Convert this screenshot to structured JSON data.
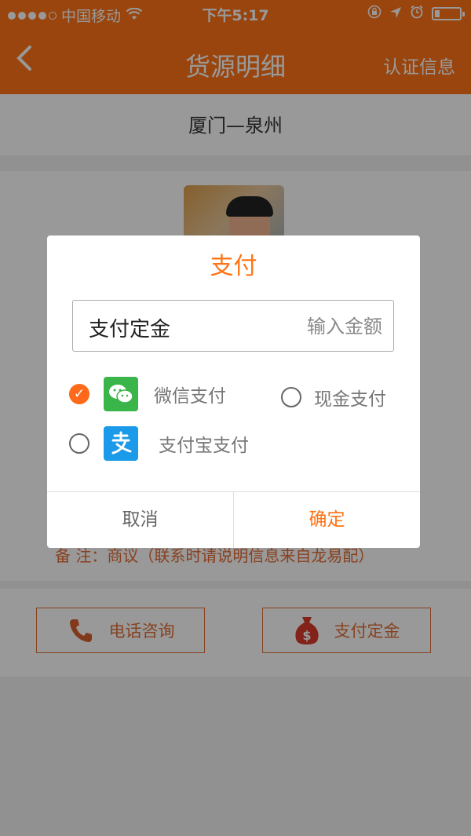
{
  "status_bar": {
    "carrier": "中国移动",
    "time": "下午5:17"
  },
  "nav": {
    "title": "货源明细",
    "right_action": "认证信息"
  },
  "route": "厦门—泉州",
  "remark": "备 注：商议（联系时请说明信息来自龙易配）",
  "actions": {
    "phone_label": "电话咨询",
    "pay_label": "支付定金"
  },
  "modal": {
    "title": "支付",
    "amount_label": "支付定金",
    "amount_placeholder": "输入金额",
    "options": [
      {
        "label": "微信支付",
        "icon": "wechat-icon",
        "selected": true
      },
      {
        "label": "现金支付",
        "icon": "",
        "selected": false
      },
      {
        "label": "支付宝支付",
        "icon": "alipay-icon",
        "selected": false
      }
    ],
    "cancel_label": "取消",
    "confirm_label": "确定"
  },
  "colors": {
    "accent": "#ff7316",
    "action_outline": "#e0703a"
  }
}
